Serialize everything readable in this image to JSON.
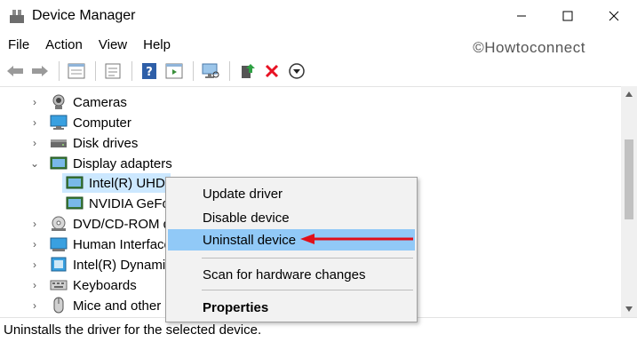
{
  "window": {
    "title": "Device Manager"
  },
  "menubar": {
    "items": [
      "File",
      "Action",
      "View",
      "Help"
    ]
  },
  "watermark": "©Howtoconnect",
  "toolbar": {
    "icons": [
      "back-icon",
      "forward-icon",
      "properties-icon",
      "show-hide-icon",
      "help-icon",
      "console-icon",
      "scan-hardware-icon",
      "update-driver-icon",
      "uninstall-icon",
      "disable-icon"
    ]
  },
  "tree": {
    "items": [
      {
        "label": "Cameras",
        "icon": "camera-icon",
        "expanded": false
      },
      {
        "label": "Computer",
        "icon": "computer-icon",
        "expanded": false
      },
      {
        "label": "Disk drives",
        "icon": "disk-drive-icon",
        "expanded": false
      },
      {
        "label": "Display adapters",
        "icon": "display-adapter-icon",
        "expanded": true
      },
      {
        "label": "Intel(R) UHD",
        "icon": "display-adapter-icon",
        "child": true,
        "selected": true
      },
      {
        "label": "NVIDIA GeFo",
        "icon": "display-adapter-icon",
        "child": true
      },
      {
        "label": "DVD/CD-ROM d",
        "icon": "dvd-icon",
        "expanded": false
      },
      {
        "label": "Human Interface",
        "icon": "hid-icon",
        "expanded": false
      },
      {
        "label": "Intel(R) Dynamic",
        "icon": "platform-icon",
        "expanded": false
      },
      {
        "label": "Keyboards",
        "icon": "keyboard-icon",
        "expanded": false
      },
      {
        "label": "Mice and other p",
        "icon": "mouse-icon",
        "expanded": false
      }
    ]
  },
  "context_menu": {
    "items": [
      {
        "label": "Update driver"
      },
      {
        "label": "Disable device"
      },
      {
        "label": "Uninstall device",
        "highlighted": true
      },
      {
        "label": "Scan for hardware changes"
      },
      {
        "label": "Properties",
        "bold": true
      }
    ]
  },
  "statusbar": {
    "text": "Uninstalls the driver for the selected device."
  },
  "colors": {
    "highlight": "#91c9f7",
    "selection": "#cce8ff",
    "arrow": "#e0101a",
    "delete": "#e81123"
  }
}
